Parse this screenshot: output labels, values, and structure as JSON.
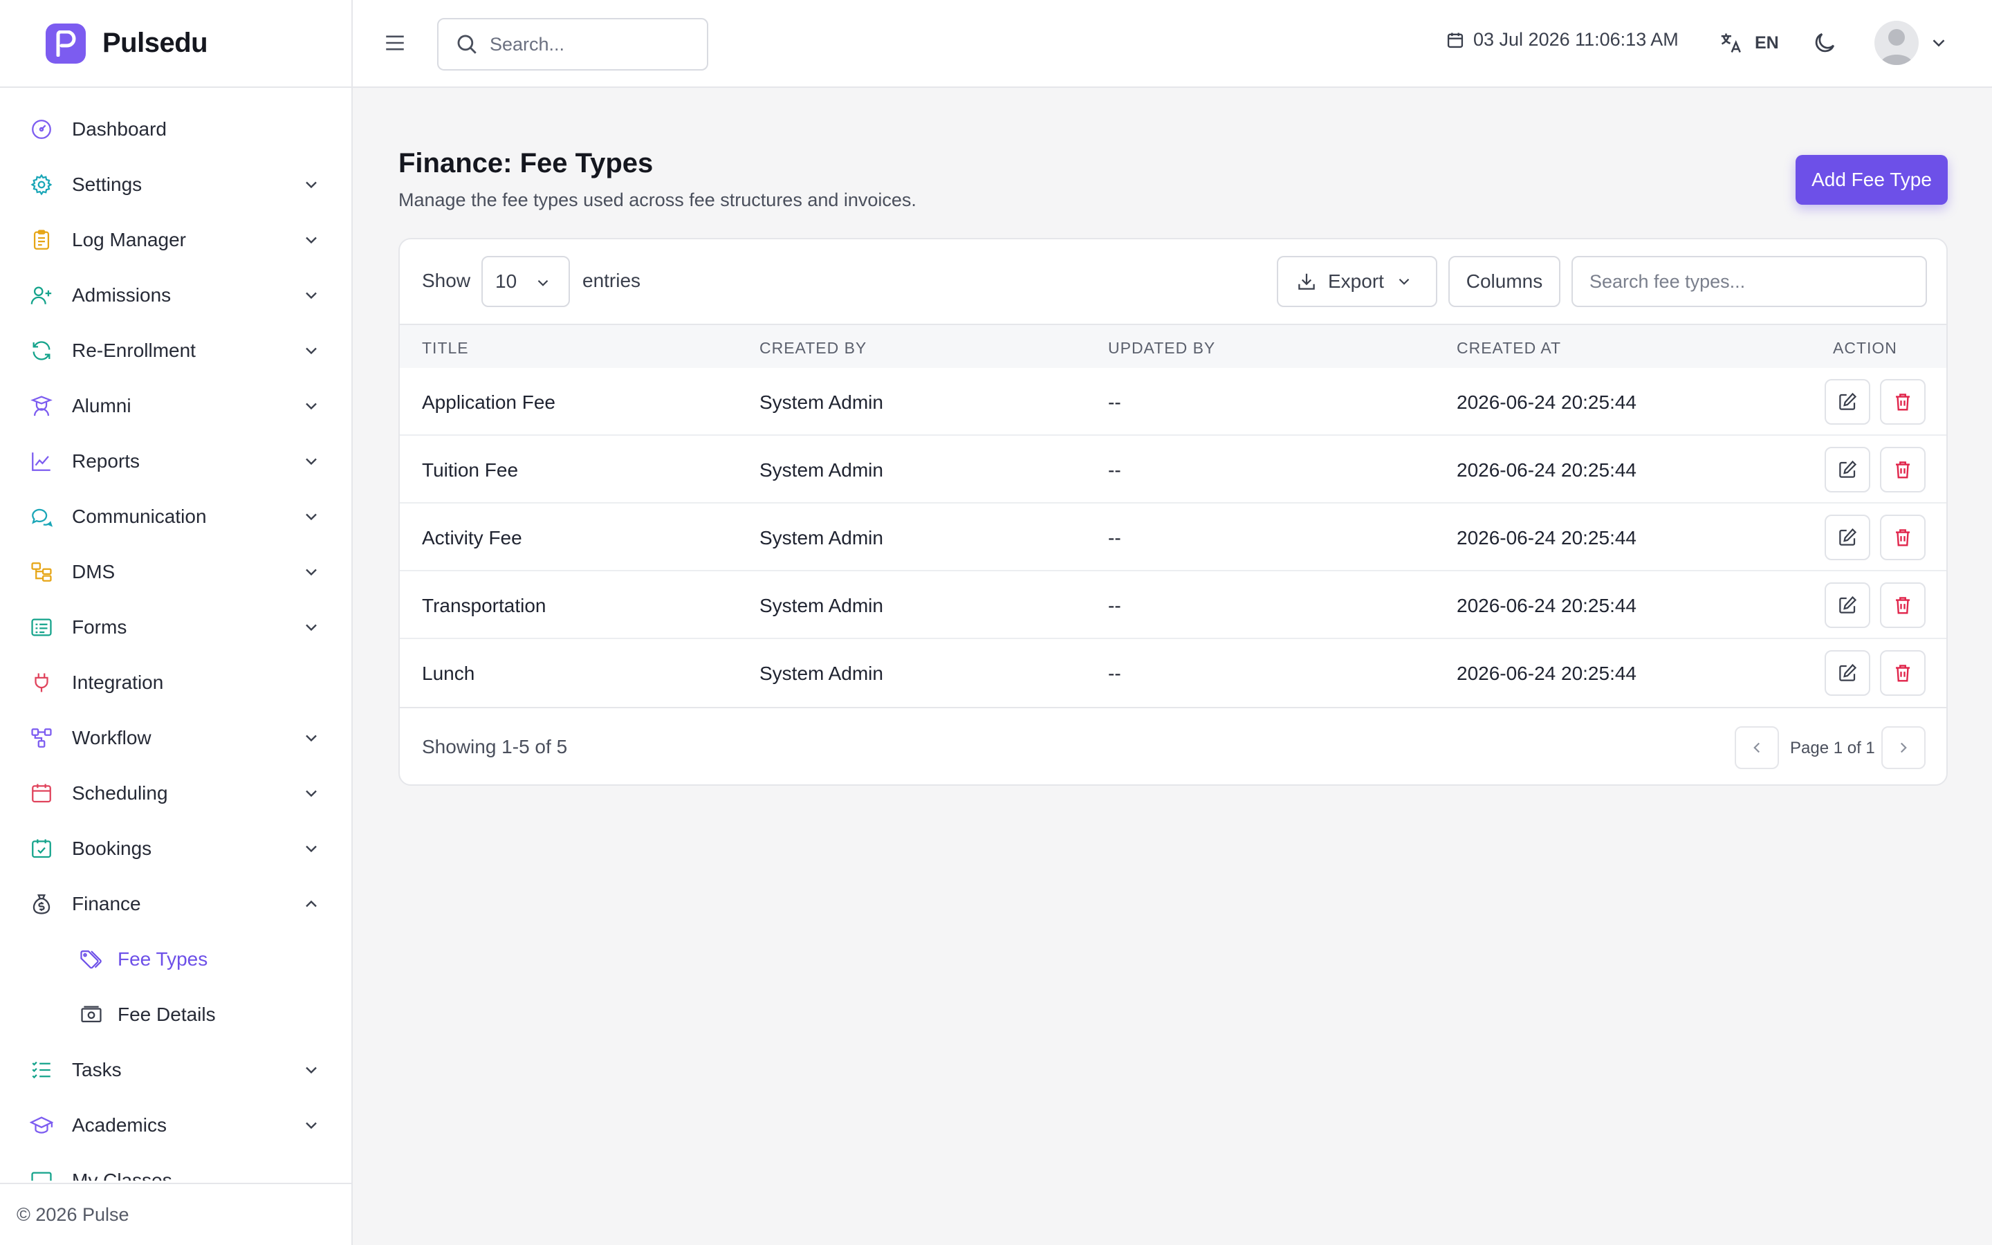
{
  "brand": {
    "name": "Pulsedu"
  },
  "sidebar": {
    "items": [
      {
        "label": "Dashboard",
        "icon": "dashboard-icon",
        "color": "#7c5cf0",
        "has_chevron": false
      },
      {
        "label": "Settings",
        "icon": "gear-icon",
        "color": "#1aa6b7",
        "has_chevron": true
      },
      {
        "label": "Log Manager",
        "icon": "clipboard-icon",
        "color": "#e6a516",
        "has_chevron": true
      },
      {
        "label": "Admissions",
        "icon": "user-plus-icon",
        "color": "#14a38b",
        "has_chevron": true
      },
      {
        "label": "Re-Enrollment",
        "icon": "refresh-icon",
        "color": "#14a38b",
        "has_chevron": true
      },
      {
        "label": "Alumni",
        "icon": "graduate-icon",
        "color": "#7c5cf0",
        "has_chevron": true
      },
      {
        "label": "Reports",
        "icon": "line-chart-icon",
        "color": "#7c5cf0",
        "has_chevron": true
      },
      {
        "label": "Communication",
        "icon": "chat-icon",
        "color": "#1aa6b7",
        "has_chevron": true
      },
      {
        "label": "DMS",
        "icon": "folder-tree-icon",
        "color": "#e6a516",
        "has_chevron": true
      },
      {
        "label": "Forms",
        "icon": "form-icon",
        "color": "#14a38b",
        "has_chevron": true
      },
      {
        "label": "Integration",
        "icon": "plug-icon",
        "color": "#e0435c",
        "has_chevron": false
      },
      {
        "label": "Workflow",
        "icon": "workflow-icon",
        "color": "#7c5cf0",
        "has_chevron": true
      },
      {
        "label": "Scheduling",
        "icon": "calendar-icon",
        "color": "#e0435c",
        "has_chevron": true
      },
      {
        "label": "Bookings",
        "icon": "calendar-check-icon",
        "color": "#14a38b",
        "has_chevron": true
      },
      {
        "label": "Finance",
        "icon": "money-bag-icon",
        "color": "#3a3f4c",
        "has_chevron": true,
        "expanded": true
      },
      {
        "label": "Tasks",
        "icon": "checklist-icon",
        "color": "#14a38b",
        "has_chevron": true
      },
      {
        "label": "Academics",
        "icon": "mortarboard-icon",
        "color": "#7c5cf0",
        "has_chevron": true
      },
      {
        "label": "My Classes",
        "icon": "class-icon",
        "color": "#14a38b",
        "has_chevron": false
      }
    ],
    "finance_sub": [
      {
        "label": "Fee Types",
        "icon": "tag-icon",
        "active": true
      },
      {
        "label": "Fee Details",
        "icon": "banknote-icon",
        "active": false
      }
    ],
    "footer": "© 2026 Pulse"
  },
  "header": {
    "search_placeholder": "Search...",
    "datetime": "03 Jul 2026 11:06:13 AM",
    "language": "EN"
  },
  "main": {
    "title": "Finance: Fee Types",
    "subtitle": "Manage the fee types used across fee structures and invoices.",
    "add_button": "Add Fee Type",
    "accent_color": "#6d50e8"
  },
  "table": {
    "show_label": "Show",
    "entries_value": "10",
    "entries_label": "entries",
    "export_label": "Export",
    "columns_label": "Columns",
    "search_placeholder": "Search fee types...",
    "headers": [
      "TITLE",
      "CREATED BY",
      "UPDATED BY",
      "CREATED AT",
      "ACTION"
    ],
    "rows": [
      [
        "Application Fee",
        "System Admin",
        "--",
        "2026-06-24 20:25:44"
      ],
      [
        "Tuition Fee",
        "System Admin",
        "--",
        "2026-06-24 20:25:44"
      ],
      [
        "Activity Fee",
        "System Admin",
        "--",
        "2026-06-24 20:25:44"
      ],
      [
        "Transportation",
        "System Admin",
        "--",
        "2026-06-24 20:25:44"
      ],
      [
        "Lunch",
        "System Admin",
        "--",
        "2026-06-24 20:25:44"
      ]
    ],
    "showing": "Showing 1-5 of 5",
    "page_info": "Page 1 of 1"
  }
}
